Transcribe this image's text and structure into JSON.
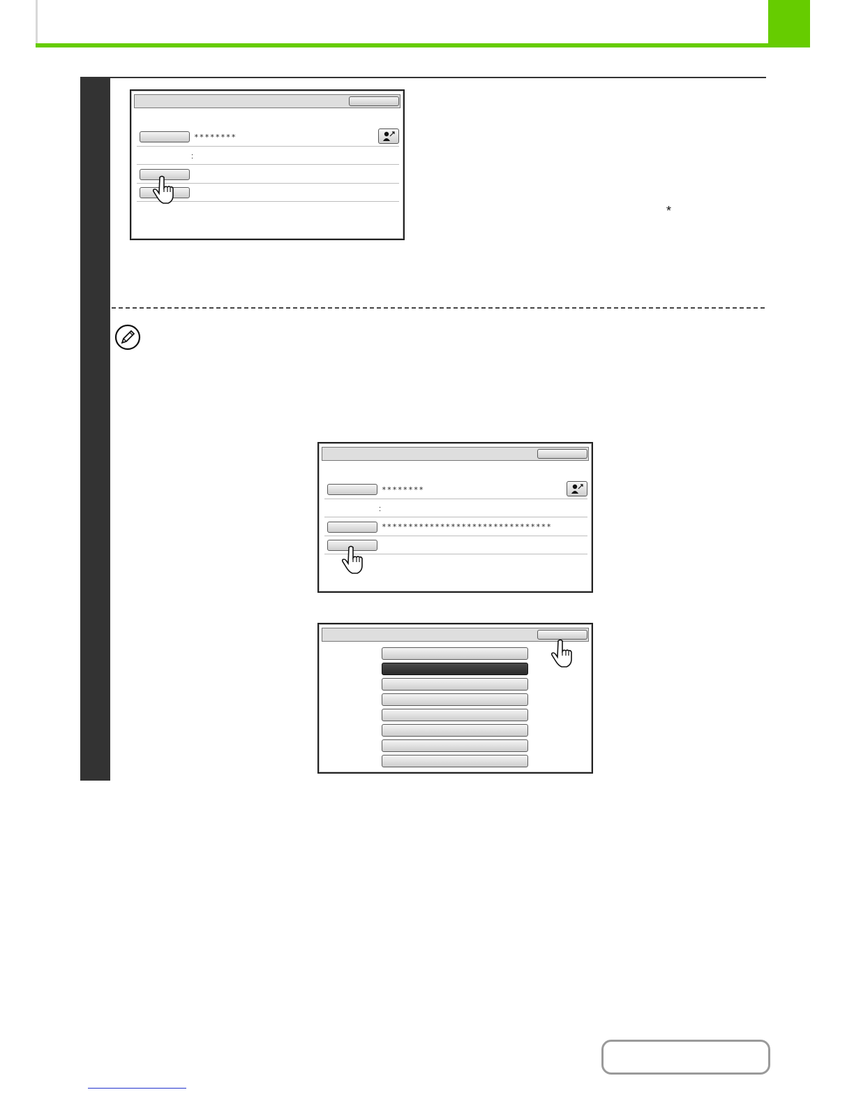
{
  "colors": {
    "accent_green": "#66cc00",
    "step_bar": "#333333",
    "footer_link": "#2233cc"
  },
  "screen1": {
    "masked_value": "********",
    "separator": ":"
  },
  "screen2": {
    "masked_value": "********",
    "separator": ":",
    "masked_long": "********************************"
  },
  "screen3": {
    "list_button_count": 8,
    "selected_index": 1
  },
  "note_symbol": "*",
  "footer": {
    "contents_label": ""
  },
  "icons": [
    "address-book-icon",
    "pointing-hand-icon",
    "pencil-note-icon"
  ]
}
